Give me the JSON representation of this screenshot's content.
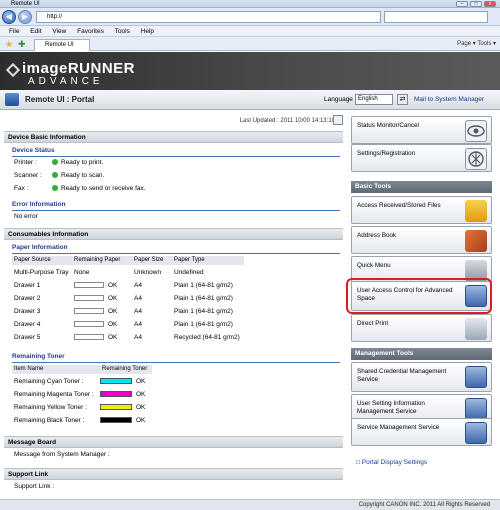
{
  "browser": {
    "window_title": "Remote UI",
    "url": "http://",
    "menu": [
      "File",
      "Edit",
      "View",
      "Favorites",
      "Tools",
      "Help"
    ],
    "tab_label": "Remote UI",
    "tab_tools": "Page ▾  Tools ▾"
  },
  "banner": {
    "logo_main": "imageRUNNER",
    "logo_sub": "ADVANCE"
  },
  "header": {
    "title": "Remote UI : Portal",
    "language_label": "Language",
    "language_value": "English",
    "mail_link": "Mail to System Manager"
  },
  "main": {
    "last_updated": "Last Updated : 2011 10/00 14:13:10",
    "device_basic": "Device Basic Information",
    "device_status": {
      "heading": "Device Status",
      "rows": [
        {
          "label": "Printer :",
          "value": "Ready to print."
        },
        {
          "label": "Scanner :",
          "value": "Ready to scan."
        },
        {
          "label": "Fax :",
          "value": "Ready to send or receive fax."
        }
      ]
    },
    "error_info": {
      "heading": "Error Information",
      "value": "No error"
    },
    "consumables": "Consumables Information",
    "paper": {
      "heading": "Paper Information",
      "headers": [
        "Paper Source",
        "Remaining Paper",
        "Paper Size",
        "Paper Type"
      ],
      "rows": [
        {
          "source": "Multi-Purpose Tray",
          "remaining": "None",
          "size": "Unknown",
          "type": "Undefined",
          "bar": false
        },
        {
          "source": "Drawer 1",
          "remaining": "OK",
          "size": "A4",
          "type": "Plain 1 (64-81 g/m2)",
          "bar": true
        },
        {
          "source": "Drawer 2",
          "remaining": "OK",
          "size": "A4",
          "type": "Plain 1 (64-81 g/m2)",
          "bar": true
        },
        {
          "source": "Drawer 3",
          "remaining": "OK",
          "size": "A4",
          "type": "Plain 1 (64-81 g/m2)",
          "bar": true
        },
        {
          "source": "Drawer 4",
          "remaining": "OK",
          "size": "A4",
          "type": "Plain 1 (64-81 g/m2)",
          "bar": true
        },
        {
          "source": "Drawer 5",
          "remaining": "OK",
          "size": "A4",
          "type": "Recycled (64-81 g/m2)",
          "bar": true
        }
      ]
    },
    "toner": {
      "heading": "Remaining Toner",
      "headers": [
        "Item Name",
        "Remaining Toner"
      ],
      "rows": [
        {
          "name": "Remaining Cyan Toner :",
          "value": "OK",
          "color": "#00e5ee"
        },
        {
          "name": "Remaining Magenta Toner :",
          "value": "OK",
          "color": "#ee00cc"
        },
        {
          "name": "Remaining Yellow Toner :",
          "value": "OK",
          "color": "#f2ee00"
        },
        {
          "name": "Remaining Black Toner :",
          "value": "OK",
          "color": "#000000"
        }
      ]
    },
    "message_board": {
      "heading": "Message Board",
      "label": "Message from System Manager :"
    },
    "support_link": {
      "heading": "Support Link",
      "label": "Support Link :"
    }
  },
  "sidebar": {
    "top_buttons": [
      {
        "label": "Status Monitor/Cancel",
        "icon": "status-monitor-icon"
      },
      {
        "label": "Settings/Registration",
        "icon": "settings-icon"
      }
    ],
    "basic_tools_heading": "Basic Tools",
    "basic_tools": [
      {
        "label": "Access Received/Stored Files",
        "icon": "files-icon"
      },
      {
        "label": "Address Book",
        "icon": "address-book-icon"
      },
      {
        "label": "Quick Menu",
        "icon": "quick-menu-icon"
      },
      {
        "label": "User Access Control for Advanced Space",
        "icon": "monitor-icon"
      },
      {
        "label": "Direct Print",
        "icon": "printer-icon"
      }
    ],
    "management_tools_heading": "Management Tools",
    "management_tools": [
      {
        "label": "Shared Credential Management Service",
        "icon": "monitor-icon"
      },
      {
        "label": "User Setting Information Management Service",
        "icon": "monitor-icon"
      },
      {
        "label": "Service Management Service",
        "icon": "monitor-icon"
      }
    ],
    "portal_display": "Portal Display Settings"
  },
  "footer": {
    "copyright": "Copyright CANON INC. 2011 All Rights Reserved"
  },
  "colors": {
    "highlight": "#d81e1e",
    "ok_dot": "#2fae3a"
  }
}
